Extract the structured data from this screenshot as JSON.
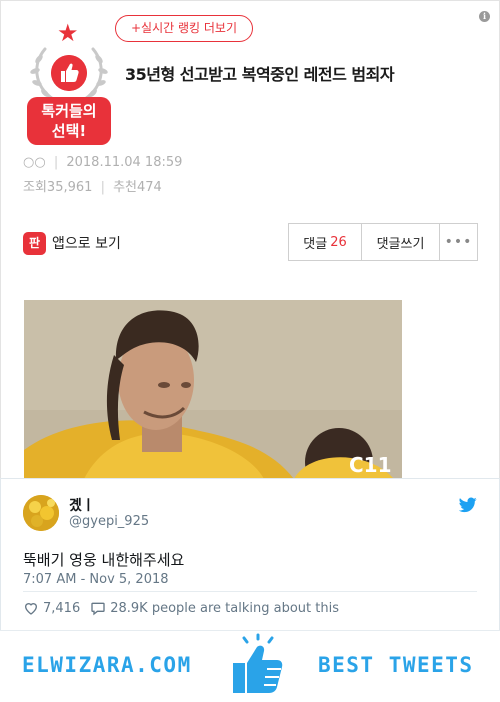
{
  "post": {
    "rank_button": "+실시간 랭킹 더보기",
    "badge_text_line1": "톡커들의",
    "badge_text_line2": "선택!",
    "title": "35년형 선고받고 복역중인 레전드 범죄자",
    "author": "○○",
    "date": "2018.11.04 18:59",
    "views_label": "조회",
    "views": "35,961",
    "likes_label": "추천",
    "likes": "474",
    "app_logo_text": "판",
    "app_view_label": "앱으로 보기",
    "comments_label": "댓글",
    "comments_count": "26",
    "write_comment_label": "댓글쓰기",
    "more_label": "•••",
    "info_icon": "i"
  },
  "tweet": {
    "name": "곘ㅣ",
    "handle": "@gyepi_925",
    "text": "뚝배기 영웅 내한해주세요",
    "time": "7:07 AM - Nov 5, 2018",
    "likes": "7,416",
    "talking": "28.9K people are talking about this"
  },
  "footer": {
    "brand_left": "ELWIZARA.COM",
    "brand_right": "BEST TWEETS"
  },
  "colors": {
    "accent_red": "#e8323a",
    "twitter_blue": "#1da1f2",
    "brand_blue": "#2aa3e8"
  },
  "icons": [
    "info-icon",
    "star-icon",
    "wreath-icon",
    "thumbs-up-icon",
    "twitter-bird-icon",
    "heart-icon",
    "speech-bubble-icon"
  ]
}
